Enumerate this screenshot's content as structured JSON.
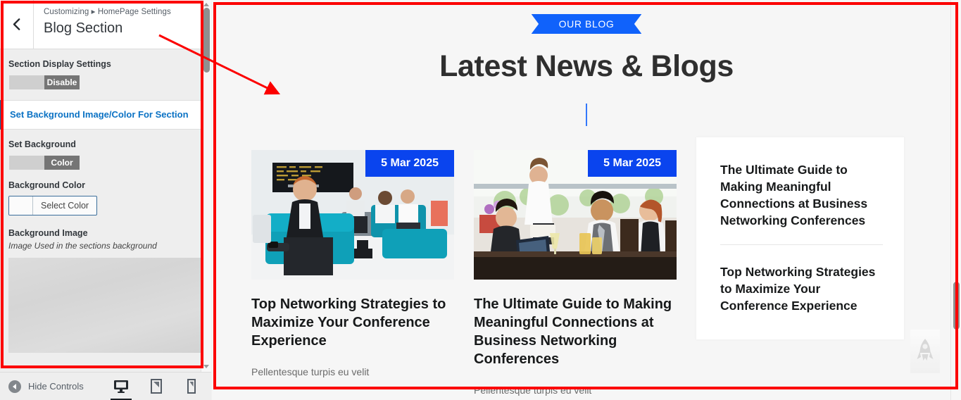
{
  "customizer": {
    "back_icon": "chevron-left-icon",
    "breadcrumb": "Customizing ▸ HomePage Settings",
    "panel_title": "Blog Section",
    "section_display_settings_label": "Section Display Settings",
    "display_toggle": {
      "state_label": "Disable",
      "icon": "toggle-switch"
    },
    "background_section_row": "Set Background Image/Color For Section",
    "set_background_label": "Set Background",
    "background_toggle": {
      "state_label": "Color",
      "icon": "toggle-switch"
    },
    "background_color_label": "Background Color",
    "select_color_button": "Select Color",
    "background_image_label": "Background Image",
    "background_image_help": "Image Used in the sections background",
    "footer": {
      "hide_controls_label": "Hide Controls",
      "devices": [
        {
          "name": "desktop-preview-icon",
          "label": "Desktop",
          "active": true
        },
        {
          "name": "tablet-preview-icon",
          "label": "Tablet",
          "active": false
        },
        {
          "name": "mobile-preview-icon",
          "label": "Mobile",
          "active": false
        }
      ]
    }
  },
  "preview": {
    "ribbon_label": "OUR BLOG",
    "heading": "Latest News & Blogs",
    "cards": [
      {
        "date": "5 Mar 2025",
        "title": "Top Networking Strategies to Maximize Your Conference Experience",
        "excerpt": "Pellentesque turpis eu velit",
        "image_alt": "businessman-airport-lounge-photo"
      },
      {
        "date": "5 Mar 2025",
        "title": "The Ultimate Guide to Making Meaningful Connections at Business Networking Conferences",
        "excerpt": "Pellentesque turpis eu velit",
        "image_alt": "business-meeting-restaurant-photo"
      }
    ],
    "side_card": {
      "items": [
        "The Ultimate Guide to Making Meaningful Connections at Business Networking Conferences",
        "Top Networking Strategies to Maximize Your Conference Experience"
      ]
    },
    "scroll_top_icon": "rocket-icon"
  },
  "colors": {
    "accent_blue": "#1062fb",
    "badge_blue": "#0a44ee",
    "link_blue": "#0b72c4",
    "annotation_red": "#fc0000",
    "heading_dark": "#2f2f2f"
  }
}
